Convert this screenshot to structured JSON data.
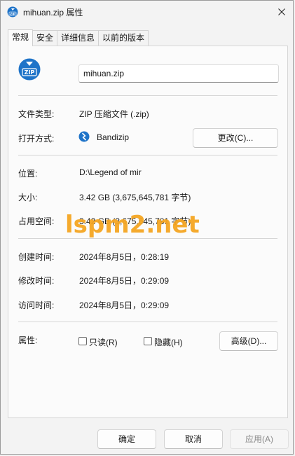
{
  "window": {
    "title": "mihuan.zip 属性"
  },
  "tabs": [
    {
      "label": "常规",
      "active": true
    },
    {
      "label": "安全",
      "active": false
    },
    {
      "label": "详细信息",
      "active": false
    },
    {
      "label": "以前的版本",
      "active": false
    }
  ],
  "file": {
    "name": "mihuan.zip",
    "icon_text": "ZIP"
  },
  "rows": {
    "type_label": "文件类型:",
    "type_value": "ZIP 压缩文件 (.zip)",
    "open_label": "打开方式:",
    "open_value": "Bandizip",
    "change_button": "更改(C)...",
    "location_label": "位置:",
    "location_value": "D:\\Legend of mir",
    "size_label": "大小:",
    "size_value": "3.42 GB (3,675,645,781 字节)",
    "disk_label": "占用空间:",
    "disk_value": "3.42 GB (3,675,645,781 字节)",
    "created_label": "创建时间:",
    "created_value": "2024年8月5日，0:28:19",
    "modified_label": "修改时间:",
    "modified_value": "2024年8月5日，0:29:09",
    "accessed_label": "访问时间:",
    "accessed_value": "2024年8月5日，0:29:09",
    "attr_label": "属性:",
    "readonly_label": "只读(R)",
    "hidden_label": "隐藏(H)",
    "advanced_button": "高级(D)..."
  },
  "footer": {
    "ok": "确定",
    "cancel": "取消",
    "apply": "应用(A)"
  },
  "watermark": "lspm2.net",
  "colors": {
    "accent": "#0067c0",
    "watermark": "#f5a623"
  }
}
